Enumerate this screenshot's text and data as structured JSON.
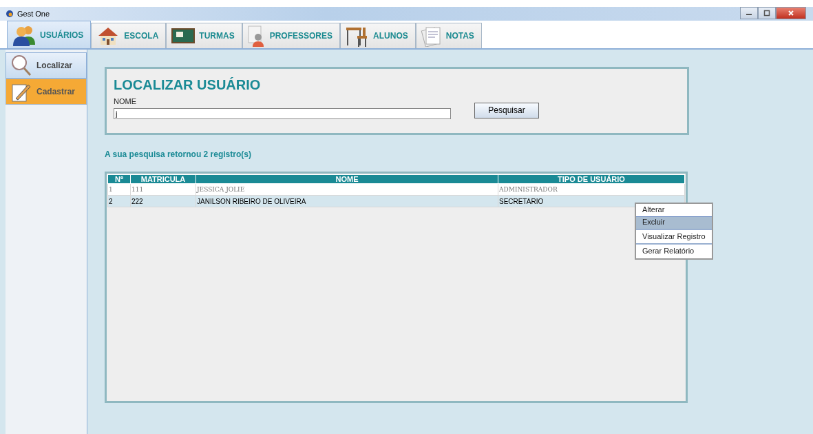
{
  "window": {
    "title": "Gest One"
  },
  "tabs": [
    {
      "label": "USUÁRIOS",
      "kind": "users",
      "selected": true
    },
    {
      "label": "ESCOLA",
      "kind": "school",
      "selected": false
    },
    {
      "label": "TURMAS",
      "kind": "board",
      "selected": false
    },
    {
      "label": "PROFESSORES",
      "kind": "teacher",
      "selected": false
    },
    {
      "label": "ALUNOS",
      "kind": "desk",
      "selected": false
    },
    {
      "label": "NOTAS",
      "kind": "notes",
      "selected": false
    }
  ],
  "sidebar": {
    "items": [
      {
        "label": "Localizar",
        "kind": "search",
        "selected": true
      },
      {
        "label": "Cadastrar",
        "kind": "pencil",
        "selected": false,
        "hover": true
      }
    ]
  },
  "search_panel": {
    "title": "LOCALIZAR USUÁRIO",
    "field_label": "NOME",
    "value": "j",
    "button": "Pesquisar"
  },
  "result_text": "A sua pesquisa retornou 2 registro(s)",
  "table": {
    "columns": [
      "Nº",
      "MATRICULA",
      "NOME",
      "TIPO DE USUÁRIO"
    ],
    "rows": [
      {
        "cells": [
          "1",
          "111",
          "JESSICA JOLIE",
          "ADMINISTRADOR"
        ],
        "selected": false
      },
      {
        "cells": [
          "2",
          "222",
          "JANILSON RIBEIRO DE OLIVEIRA",
          "SECRETARIO"
        ],
        "selected": true
      }
    ]
  },
  "context_menu": {
    "items": [
      {
        "label": "Alterar",
        "selected": false,
        "separator_after": false
      },
      {
        "label": "Excluir",
        "selected": true,
        "separator_after": true
      },
      {
        "label": "Visualizar Registro",
        "selected": false,
        "separator_after": true
      },
      {
        "label": "Gerar Relatório",
        "selected": false,
        "separator_after": false
      }
    ]
  }
}
